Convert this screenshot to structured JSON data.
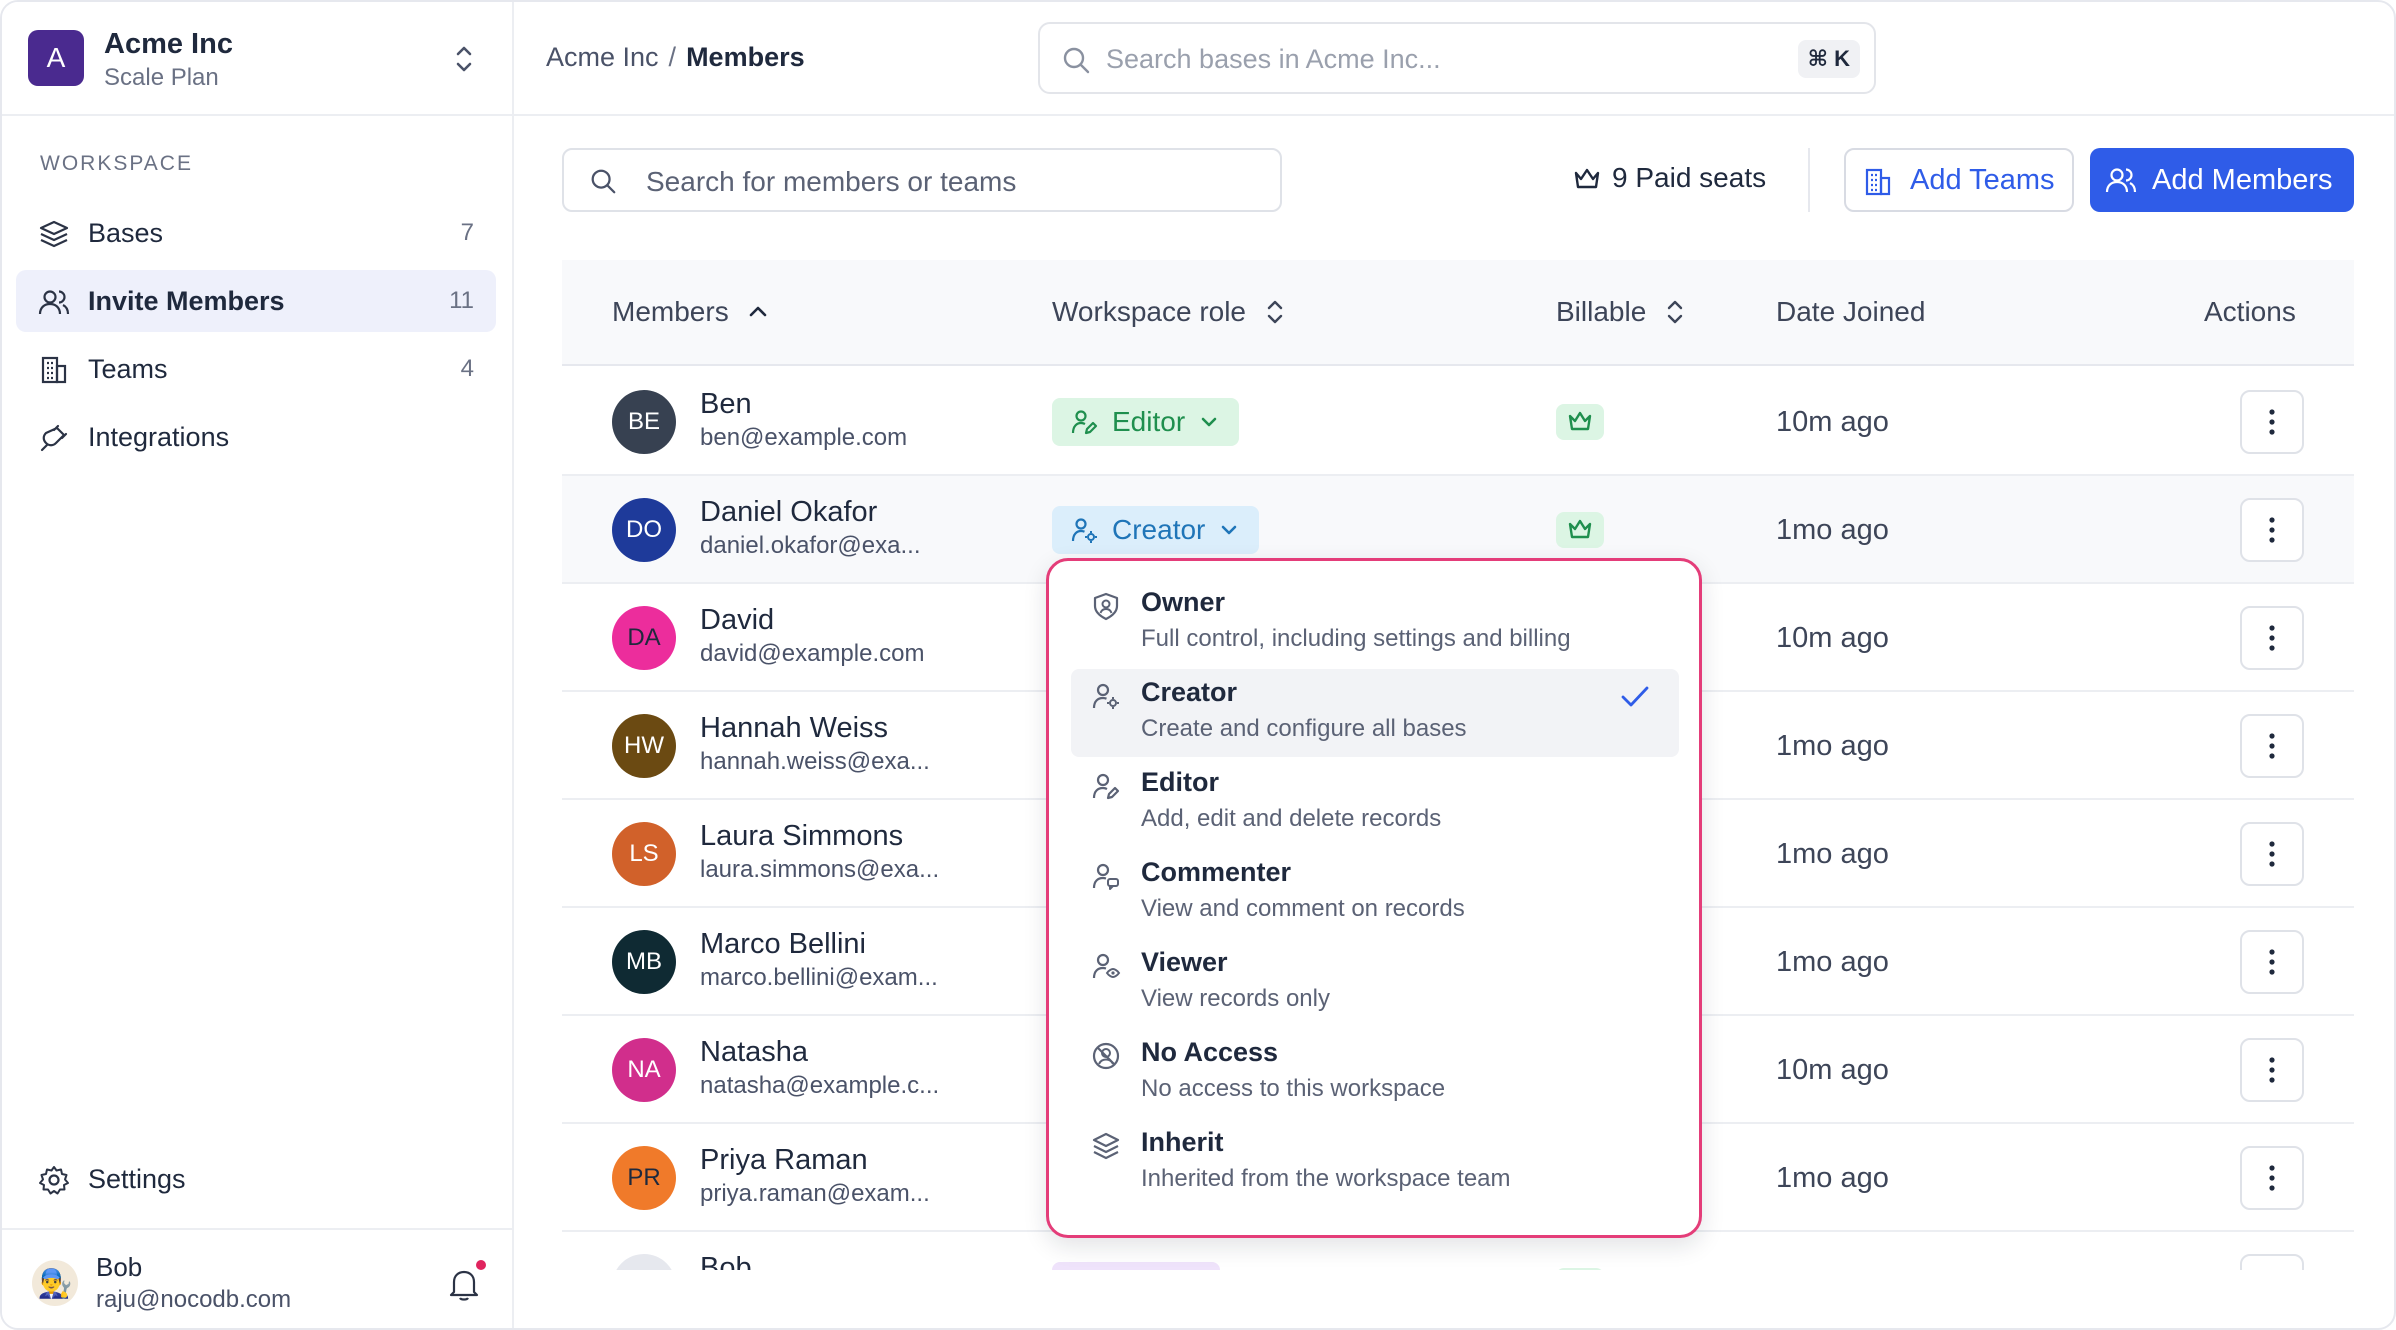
{
  "workspace": {
    "initial": "A",
    "name": "Acme Inc",
    "plan": "Scale Plan",
    "section_label": "WORKSPACE"
  },
  "sidebar": {
    "items": [
      {
        "label": "Bases",
        "count": "7",
        "icon": "layers-icon"
      },
      {
        "label": "Invite Members",
        "count": "11",
        "icon": "users-icon",
        "active": true
      },
      {
        "label": "Teams",
        "count": "4",
        "icon": "building-icon"
      },
      {
        "label": "Integrations",
        "count": "",
        "icon": "plug-icon"
      }
    ],
    "settings_label": "Settings"
  },
  "user": {
    "name": "Bob",
    "email": "raju@nocodb.com",
    "avatar_emoji": "👨‍🔧"
  },
  "breadcrumb": {
    "parent": "Acme Inc",
    "separator": "/",
    "current": "Members"
  },
  "base_search": {
    "placeholder": "Search bases in Acme Inc...",
    "shortcut": "⌘ K"
  },
  "toolbar": {
    "search_placeholder": "Search for members or teams",
    "paid_seats": "9 Paid seats",
    "add_teams": "Add Teams",
    "add_members": "Add Members"
  },
  "table": {
    "columns": {
      "members": "Members",
      "role": "Workspace role",
      "billable": "Billable",
      "joined": "Date Joined",
      "actions": "Actions"
    },
    "rows": [
      {
        "initials": "BE",
        "name": "Ben",
        "email": "ben@example.com",
        "role": "Editor",
        "billable": true,
        "joined": "10m ago",
        "color": "#374151"
      },
      {
        "initials": "DO",
        "name": "Daniel Okafor",
        "email": "daniel.okafor@exa...",
        "role": "Creator",
        "billable": true,
        "joined": "1mo ago",
        "color": "#1e3a9a"
      },
      {
        "initials": "DA",
        "name": "David",
        "email": "david@example.com",
        "role": "",
        "billable": false,
        "joined": "10m ago",
        "color": "#ec2d9c",
        "text_color": "#1f293d"
      },
      {
        "initials": "HW",
        "name": "Hannah Weiss",
        "email": "hannah.weiss@exa...",
        "role": "",
        "billable": false,
        "joined": "1mo ago",
        "color": "#6b4a12"
      },
      {
        "initials": "LS",
        "name": "Laura Simmons",
        "email": "laura.simmons@exa...",
        "role": "",
        "billable": false,
        "joined": "1mo ago",
        "color": "#d1612a"
      },
      {
        "initials": "MB",
        "name": "Marco Bellini",
        "email": "marco.bellini@exam...",
        "role": "",
        "billable": false,
        "joined": "1mo ago",
        "color": "#0f2a33"
      },
      {
        "initials": "NA",
        "name": "Natasha",
        "email": "natasha@example.c...",
        "role": "",
        "billable": false,
        "joined": "10m ago",
        "color": "#d12e8c"
      },
      {
        "initials": "PR",
        "name": "Priya Raman",
        "email": "priya.raman@exam...",
        "role": "",
        "billable": false,
        "joined": "1mo ago",
        "color": "#f07a2a",
        "text_color": "#1f293d"
      },
      {
        "initials": "",
        "name": "Bob",
        "email": "",
        "role": "",
        "billable": true,
        "joined": "",
        "color": "#e6e8ee"
      }
    ]
  },
  "role_dropdown": {
    "options": [
      {
        "title": "Owner",
        "desc": "Full control, including settings and billing",
        "icon": "shield-user-icon"
      },
      {
        "title": "Creator",
        "desc": "Create and configure all bases",
        "icon": "user-gear-icon",
        "selected": true
      },
      {
        "title": "Editor",
        "desc": "Add, edit and delete records",
        "icon": "user-pen-icon"
      },
      {
        "title": "Commenter",
        "desc": "View and comment on records",
        "icon": "user-comment-icon"
      },
      {
        "title": "Viewer",
        "desc": "View records only",
        "icon": "user-eye-icon"
      },
      {
        "title": "No Access",
        "desc": "No access to this workspace",
        "icon": "no-access-icon"
      },
      {
        "title": "Inherit",
        "desc": "Inherited from the workspace team",
        "icon": "layers-icon"
      }
    ]
  },
  "colors": {
    "accent": "#2f5ce8",
    "dropdown_border": "#e43d79",
    "editor_bg": "#dcf5e4",
    "creator_bg": "#dbeefb"
  }
}
